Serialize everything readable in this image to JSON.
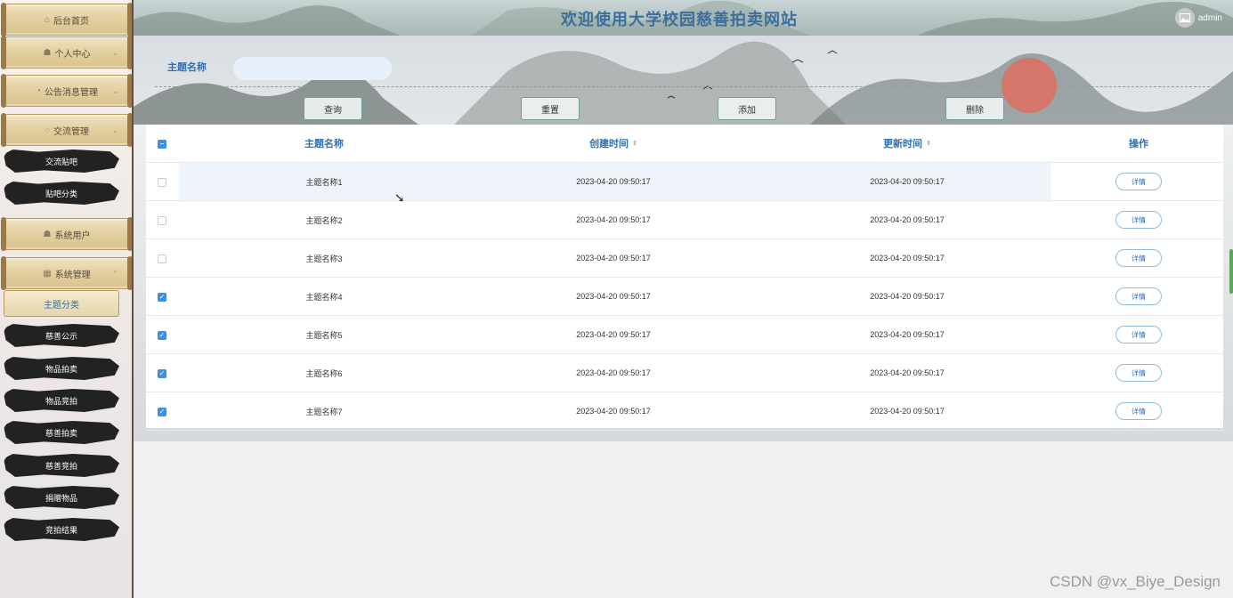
{
  "header": {
    "title": "欢迎使用大学校园慈善拍卖网站",
    "username": "admin",
    "avatar_icon": "image-icon"
  },
  "sidebar": {
    "menu": [
      {
        "label": "后台首页",
        "icon": "home-icon",
        "style": "scroll"
      },
      {
        "label": "个人中心",
        "icon": "user-icon",
        "style": "scroll"
      },
      {
        "label": "公告消息管理",
        "icon": "bell-icon",
        "style": "scroll"
      },
      {
        "label": "交流管理",
        "icon": "chat-icon",
        "style": "scroll"
      },
      {
        "label": "交流贴吧",
        "style": "brush"
      },
      {
        "label": "贴吧分类",
        "style": "brush"
      },
      {
        "label": "系统用户",
        "icon": "user-icon",
        "style": "scroll"
      },
      {
        "label": "系统管理",
        "icon": "grid-icon",
        "style": "scroll"
      },
      {
        "label": "主题分类",
        "style": "active"
      },
      {
        "label": "慈善公示",
        "style": "brush"
      },
      {
        "label": "物品拍卖",
        "style": "brush"
      },
      {
        "label": "物品竞拍",
        "style": "brush"
      },
      {
        "label": "慈善拍卖",
        "style": "brush"
      },
      {
        "label": "慈善竞拍",
        "style": "brush"
      },
      {
        "label": "捐赠物品",
        "style": "brush"
      },
      {
        "label": "竞拍结果",
        "style": "brush"
      }
    ]
  },
  "search": {
    "label": "主题名称",
    "value": "",
    "placeholder": "",
    "buttons": {
      "query": "查询",
      "reset": "重置",
      "add": "添加",
      "delete": "删除"
    }
  },
  "table": {
    "columns": {
      "name": "主题名称",
      "created": "创建时间",
      "updated": "更新时间",
      "actions": "操作"
    },
    "detail_label": "详情",
    "rows": [
      {
        "name": "主题名称1",
        "created": "2023-04-20 09:50:17",
        "updated": "2023-04-20 09:50:17",
        "checked": false
      },
      {
        "name": "主题名称2",
        "created": "2023-04-20 09:50:17",
        "updated": "2023-04-20 09:50:17",
        "checked": false
      },
      {
        "name": "主题名称3",
        "created": "2023-04-20 09:50:17",
        "updated": "2023-04-20 09:50:17",
        "checked": false
      },
      {
        "name": "主题名称4",
        "created": "2023-04-20 09:50:17",
        "updated": "2023-04-20 09:50:17",
        "checked": true
      },
      {
        "name": "主题名称5",
        "created": "2023-04-20 09:50:17",
        "updated": "2023-04-20 09:50:17",
        "checked": true
      },
      {
        "name": "主题名称6",
        "created": "2023-04-20 09:50:17",
        "updated": "2023-04-20 09:50:17",
        "checked": true
      },
      {
        "name": "主题名称7",
        "created": "2023-04-20 09:50:17",
        "updated": "2023-04-20 09:50:17",
        "checked": true
      }
    ]
  },
  "watermark": "CSDN @vx_Biye_Design",
  "colors": {
    "accent": "#2f6fb3",
    "checkbox": "#3f8fe0",
    "sidebar_border": "#6e4a3a"
  }
}
